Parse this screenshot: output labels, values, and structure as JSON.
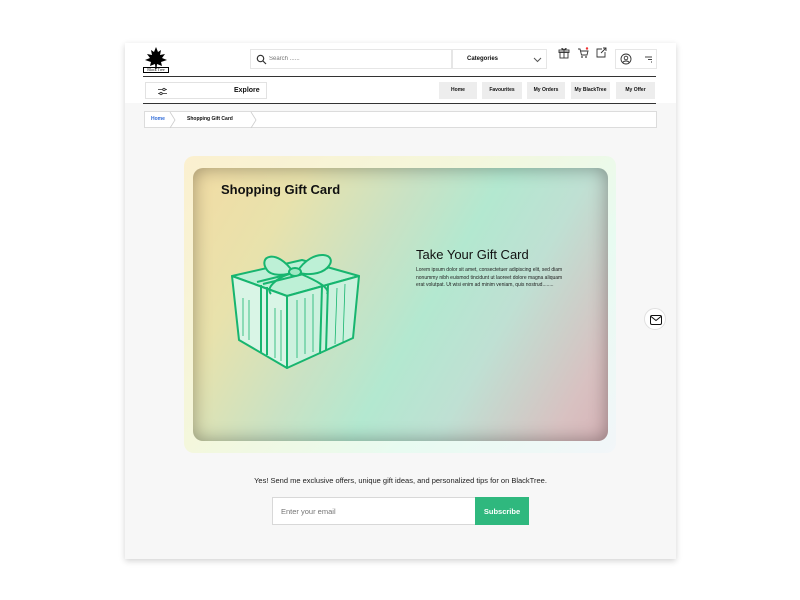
{
  "brand": {
    "logo_text": "Black Tree"
  },
  "search": {
    "placeholder": "Search ......"
  },
  "categories": {
    "label": "Categories"
  },
  "header_icons": [
    "gift-icon",
    "cart-icon",
    "share-icon",
    "user-icon",
    "menu-icon"
  ],
  "nav": {
    "explore_label": "Explore",
    "buttons": [
      "Home",
      "Favourites",
      "My Orders",
      "My BlackTree",
      "My Offer"
    ]
  },
  "breadcrumb": {
    "items": [
      "Home",
      "Shopping Gift Card"
    ],
    "active_color": "#2f6bd8"
  },
  "card": {
    "title": "Shopping Gift Card",
    "heading": "Take Your Gift Card",
    "body": "Lorem ipsum dolor sit amet, consectetuer adipiscing elit, sed diam nonummy nibh euismod tincidunt ut laoreet dolore magna aliquam erat volutpat. Ut wisi enim ad minim veniam, quis nostrud........"
  },
  "newsletter": {
    "text": "Yes! Send me exclusive offers, unique gift ideas, and personalized tips for on BlackTree.",
    "placeholder": "Enter your email",
    "button_label": "Subscribe"
  },
  "colors": {
    "accent": "#2fb87e",
    "gift_green": "#1ec07a"
  }
}
